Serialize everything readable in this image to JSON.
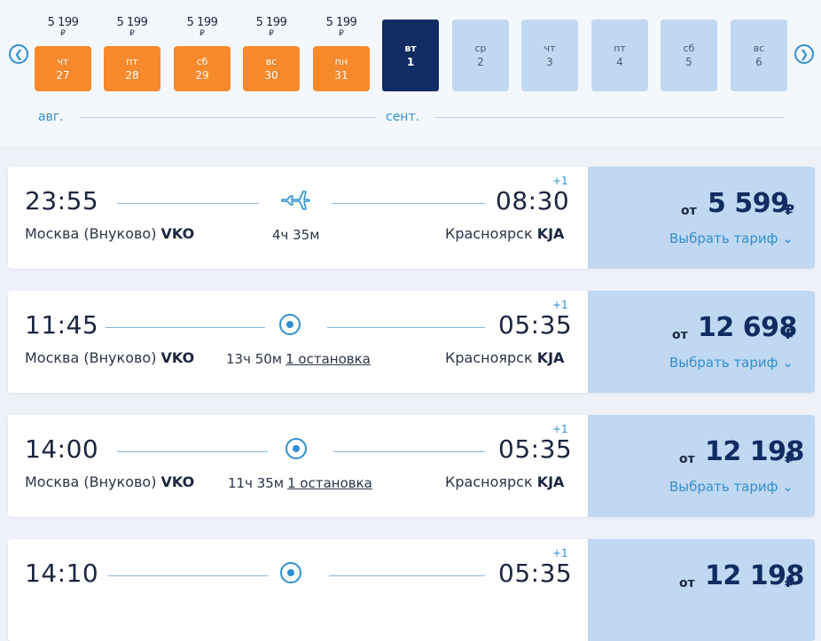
{
  "calendar": {
    "prev_icon": "chevron-left-icon",
    "next_icon": "chevron-right-icon",
    "currency": "₽",
    "days": [
      {
        "price": "5 199",
        "dow": "чт",
        "num": "27",
        "state": "orange"
      },
      {
        "price": "5 199",
        "dow": "пт",
        "num": "28",
        "state": "orange"
      },
      {
        "price": "5 199",
        "dow": "сб",
        "num": "29",
        "state": "orange"
      },
      {
        "price": "5 199",
        "dow": "вс",
        "num": "30",
        "state": "orange"
      },
      {
        "price": "5 199",
        "dow": "пн",
        "num": "31",
        "state": "orange"
      },
      {
        "price": "",
        "dow": "вт",
        "num": "1",
        "state": "selected"
      },
      {
        "price": "",
        "dow": "ср",
        "num": "2",
        "state": "light"
      },
      {
        "price": "",
        "dow": "чт",
        "num": "3",
        "state": "light"
      },
      {
        "price": "",
        "dow": "пт",
        "num": "4",
        "state": "light"
      },
      {
        "price": "",
        "dow": "сб",
        "num": "5",
        "state": "light"
      },
      {
        "price": "",
        "dow": "вс",
        "num": "6",
        "state": "light"
      }
    ],
    "months": {
      "aug": "авг.",
      "sep": "сент."
    }
  },
  "flights": [
    {
      "dep_time": "23:55",
      "arr_time": "08:30",
      "next_day": "+1",
      "from_city": "Москва (Внуково)",
      "from_code": "VKO",
      "to_city": "Красноярск",
      "to_code": "KJA",
      "duration": "4ч 35м",
      "stops": "",
      "icon": "plane-icon",
      "price_prefix": "от",
      "price": "5 599",
      "currency": "₽",
      "tariff": "Выбрать тариф"
    },
    {
      "dep_time": "11:45",
      "arr_time": "05:35",
      "next_day": "+1",
      "from_city": "Москва (Внуково)",
      "from_code": "VKO",
      "to_city": "Красноярск",
      "to_code": "KJA",
      "duration": "13ч 50м",
      "stops": "1 остановка",
      "icon": "stop-icon",
      "price_prefix": "от",
      "price": "12 698",
      "currency": "₽",
      "tariff": "Выбрать тариф"
    },
    {
      "dep_time": "14:00",
      "arr_time": "05:35",
      "next_day": "+1",
      "from_city": "Москва (Внуково)",
      "from_code": "VKO",
      "to_city": "Красноярск",
      "to_code": "KJA",
      "duration": "11ч 35м",
      "stops": "1 остановка",
      "icon": "stop-icon",
      "price_prefix": "от",
      "price": "12 198",
      "currency": "₽",
      "tariff": "Выбрать тариф"
    },
    {
      "dep_time": "14:10",
      "arr_time": "05:35",
      "next_day": "+1",
      "from_city": "",
      "from_code": "",
      "to_city": "",
      "to_code": "",
      "duration": "",
      "stops": "",
      "icon": "stop-icon",
      "price_prefix": "от",
      "price": "12 198",
      "currency": "₽",
      "tariff": ""
    }
  ]
}
